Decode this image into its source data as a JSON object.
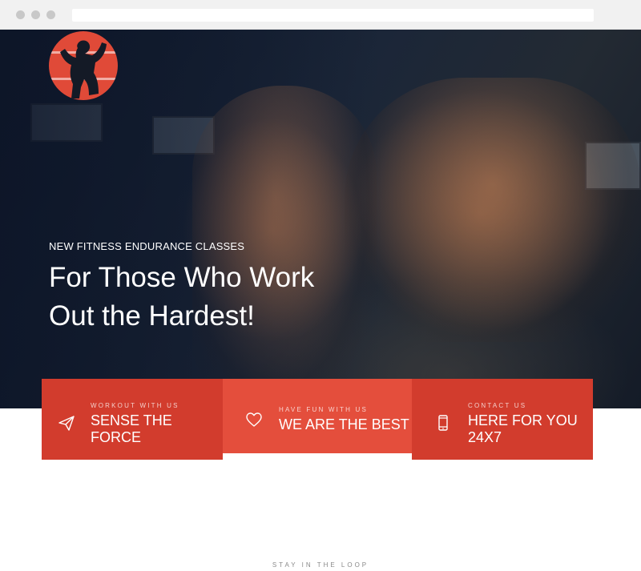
{
  "hero": {
    "logo": {
      "icon": "bodybuilder-silhouette-icon",
      "color": "#e04a38"
    },
    "eyebrow": "NEW FITNESS ENDURANCE CLASSES",
    "headline_line1": "For Those Who Work",
    "headline_line2": "Out the Hardest!"
  },
  "features": [
    {
      "kicker": "WORKOUT WITH US",
      "title": "SENSE THE FORCE",
      "icon": "paper-plane-icon",
      "color": "#d23c2d"
    },
    {
      "kicker": "HAVE FUN WITH US",
      "title": "WE ARE THE BEST",
      "icon": "heart-icon",
      "color": "#e44e3c"
    },
    {
      "kicker": "CONTACT US",
      "title": "HERE FOR YOU 24X7",
      "icon": "mobile-phone-icon",
      "color": "#d23c2d"
    }
  ],
  "newsletter": {
    "heading": "STAY IN THE LOOP"
  }
}
